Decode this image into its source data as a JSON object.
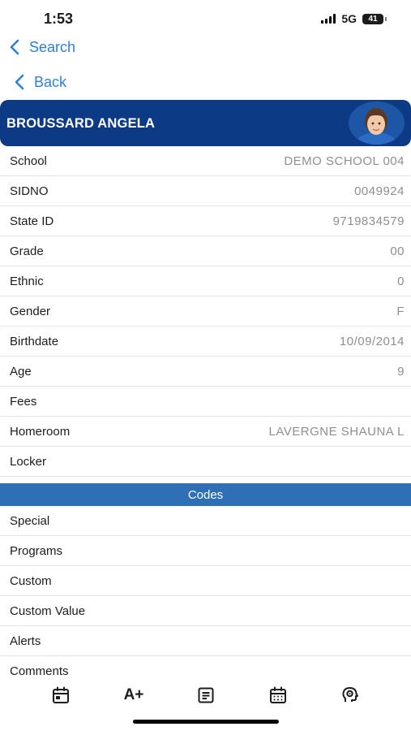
{
  "status_bar": {
    "time": "1:53",
    "network": "5G",
    "battery": "41"
  },
  "nav": {
    "search_label": "Search",
    "back_label": "Back"
  },
  "header": {
    "student_name": "BROUSSARD ANGELA",
    "photo_icon": "student-photo"
  },
  "info_rows": [
    {
      "label": "School",
      "value": "DEMO SCHOOL 004"
    },
    {
      "label": "SIDNO",
      "value": "0049924"
    },
    {
      "label": "State ID",
      "value": "9719834579"
    },
    {
      "label": "Grade",
      "value": "00"
    },
    {
      "label": "Ethnic",
      "value": "0"
    },
    {
      "label": "Gender",
      "value": "F"
    },
    {
      "label": "Birthdate",
      "value": "10/09/2014"
    },
    {
      "label": "Age",
      "value": "9"
    },
    {
      "label": "Fees",
      "value": ""
    },
    {
      "label": "Homeroom",
      "value": "LAVERGNE SHAUNA L"
    },
    {
      "label": "Locker",
      "value": ""
    }
  ],
  "codes": {
    "title": "Codes",
    "rows": [
      {
        "label": "Special"
      },
      {
        "label": "Programs"
      },
      {
        "label": "Custom"
      },
      {
        "label": "Custom Value"
      },
      {
        "label": "Alerts"
      },
      {
        "label": "Comments"
      }
    ]
  },
  "tab_bar": {
    "items": [
      {
        "icon": "calendar-day-icon"
      },
      {
        "icon": "grades-icon",
        "label": "A+"
      },
      {
        "icon": "document-list-icon"
      },
      {
        "icon": "calendar-month-icon"
      },
      {
        "icon": "health-head-icon"
      }
    ]
  },
  "colors": {
    "accent": "#2f7fd8",
    "header_bg": "#0d3a85",
    "section_bg": "#2f6fb5"
  }
}
